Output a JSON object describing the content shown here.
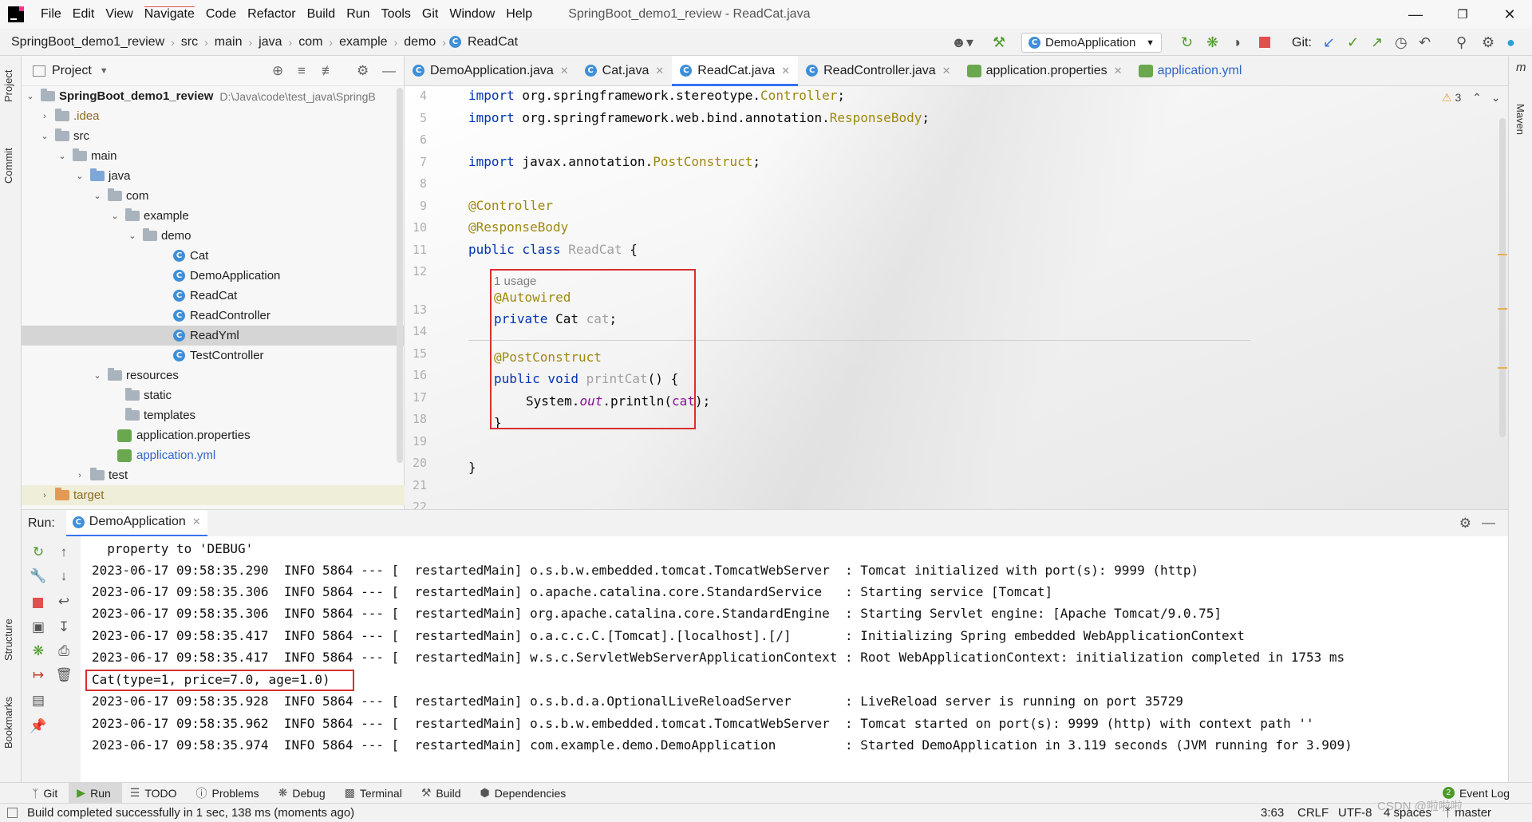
{
  "menubar": {
    "logo": "IJ",
    "items": [
      "File",
      "Edit",
      "View",
      "Navigate",
      "Code",
      "Refactor",
      "Build",
      "Run",
      "Tools",
      "Git",
      "Window",
      "Help"
    ],
    "window_title": "SpringBoot_demo1_review - ReadCat.java"
  },
  "navbar": {
    "breadcrumbs": [
      "SpringBoot_demo1_review",
      "src",
      "main",
      "java",
      "com",
      "example",
      "demo"
    ],
    "current_class": "ReadCat",
    "run_config": "DemoApplication",
    "git_label": "Git:"
  },
  "left_stripe": {
    "project": "Project",
    "commit": "Commit",
    "structure": "Structure",
    "bookmarks": "Bookmarks"
  },
  "right_stripe": {
    "maven": "Maven"
  },
  "project_panel": {
    "title": "Project",
    "tree": [
      {
        "label": "SpringBoot_demo1_review",
        "extra": "D:\\Java\\code\\test_java\\SpringB",
        "kind": "folder"
      },
      {
        "label": ".idea",
        "kind": "folder"
      },
      {
        "label": "src",
        "kind": "folder"
      },
      {
        "label": "main",
        "kind": "folder"
      },
      {
        "label": "java",
        "kind": "folder"
      },
      {
        "label": "com",
        "kind": "folder"
      },
      {
        "label": "example",
        "kind": "folder"
      },
      {
        "label": "demo",
        "kind": "folder"
      },
      {
        "label": "Cat",
        "kind": "class"
      },
      {
        "label": "DemoApplication",
        "kind": "class"
      },
      {
        "label": "ReadCat",
        "kind": "class"
      },
      {
        "label": "ReadController",
        "kind": "class"
      },
      {
        "label": "ReadYml",
        "kind": "class"
      },
      {
        "label": "TestController",
        "kind": "class"
      },
      {
        "label": "resources",
        "kind": "folder"
      },
      {
        "label": "static",
        "kind": "folder"
      },
      {
        "label": "templates",
        "kind": "folder"
      },
      {
        "label": "application.properties",
        "kind": "file"
      },
      {
        "label": "application.yml",
        "kind": "file"
      },
      {
        "label": "test",
        "kind": "folder"
      },
      {
        "label": "target",
        "kind": "folder"
      }
    ]
  },
  "editor": {
    "tabs": [
      "DemoApplication.java",
      "Cat.java",
      "ReadCat.java",
      "ReadController.java",
      "application.properties",
      "application.yml"
    ],
    "active_tab": "ReadCat.java",
    "warning_count": "3",
    "line_numbers": [
      "4",
      "5",
      "6",
      "7",
      "8",
      "9",
      "10",
      "11",
      "12",
      "13",
      "14",
      "15",
      "16",
      "17",
      "18",
      "19",
      "20",
      "21",
      "22"
    ],
    "code": {
      "l4_kw": "import",
      "l4_a": " org.springframework.stereotype.",
      "l4_b": "Controller",
      "l4_c": ";",
      "l5_kw": "import",
      "l5_a": " org.springframework.web.bind.annotation.",
      "l5_b": "ResponseBody",
      "l5_c": ";",
      "l7_kw": "import",
      "l7_a": " javax.annotation.",
      "l7_b": "PostConstruct",
      "l7_c": ";",
      "l9": "@Controller",
      "l10": "@ResponseBody",
      "l11_kw": "public class",
      "l11_name": " ReadCat",
      "l11_brace": " {",
      "usage_hint": "1 usage",
      "l13": "@Autowired",
      "l14_kw": "private",
      "l14_type": " Cat",
      "l14_name": " cat",
      "l14_end": ";",
      "l16": "@PostConstruct",
      "l17_kw": "public void",
      "l17_name": " printCat",
      "l17_end": "() {",
      "l18_a": "System.",
      "l18_out": "out",
      "l18_b": ".println(",
      "l18_arg": "cat",
      "l18_c": ");",
      "l19": "}",
      "l21": "}"
    }
  },
  "run_panel": {
    "label": "Run:",
    "tab": "DemoApplication",
    "console_lines": [
      "  property to 'DEBUG'",
      "2023-06-17 09:58:35.290  INFO 5864 --- [  restartedMain] o.s.b.w.embedded.tomcat.TomcatWebServer  : Tomcat initialized with port(s): 9999 (http)",
      "2023-06-17 09:58:35.306  INFO 5864 --- [  restartedMain] o.apache.catalina.core.StandardService   : Starting service [Tomcat]",
      "2023-06-17 09:58:35.306  INFO 5864 --- [  restartedMain] org.apache.catalina.core.StandardEngine  : Starting Servlet engine: [Apache Tomcat/9.0.75]",
      "2023-06-17 09:58:35.417  INFO 5864 --- [  restartedMain] o.a.c.c.C.[Tomcat].[localhost].[/]       : Initializing Spring embedded WebApplicationContext",
      "2023-06-17 09:58:35.417  INFO 5864 --- [  restartedMain] w.s.c.ServletWebServerApplicationContext : Root WebApplicationContext: initialization completed in 1753 ms",
      "Cat(type=1, price=7.0, age=1.0)",
      "2023-06-17 09:58:35.928  INFO 5864 --- [  restartedMain] o.s.b.d.a.OptionalLiveReloadServer       : LiveReload server is running on port 35729",
      "2023-06-17 09:58:35.962  INFO 5864 --- [  restartedMain] o.s.b.w.embedded.tomcat.TomcatWebServer  : Tomcat started on port(s): 9999 (http) with context path ''",
      "2023-06-17 09:58:35.974  INFO 5864 --- [  restartedMain] com.example.demo.DemoApplication         : Started DemoApplication in 3.119 seconds (JVM running for 3.909)"
    ]
  },
  "tool_windows": [
    "Git",
    "Run",
    "TODO",
    "Problems",
    "Debug",
    "Terminal",
    "Build",
    "Dependencies"
  ],
  "event_log": {
    "count": "2",
    "label": "Event Log"
  },
  "statusbar": {
    "message": "Build completed successfully in 1 sec, 138 ms (moments ago)",
    "position": "3:63",
    "line_sep": "CRLF",
    "encoding": "UTF-8",
    "indent": "4 spaces",
    "branch": "master",
    "watermark": "CSDN @啦啦啦"
  }
}
